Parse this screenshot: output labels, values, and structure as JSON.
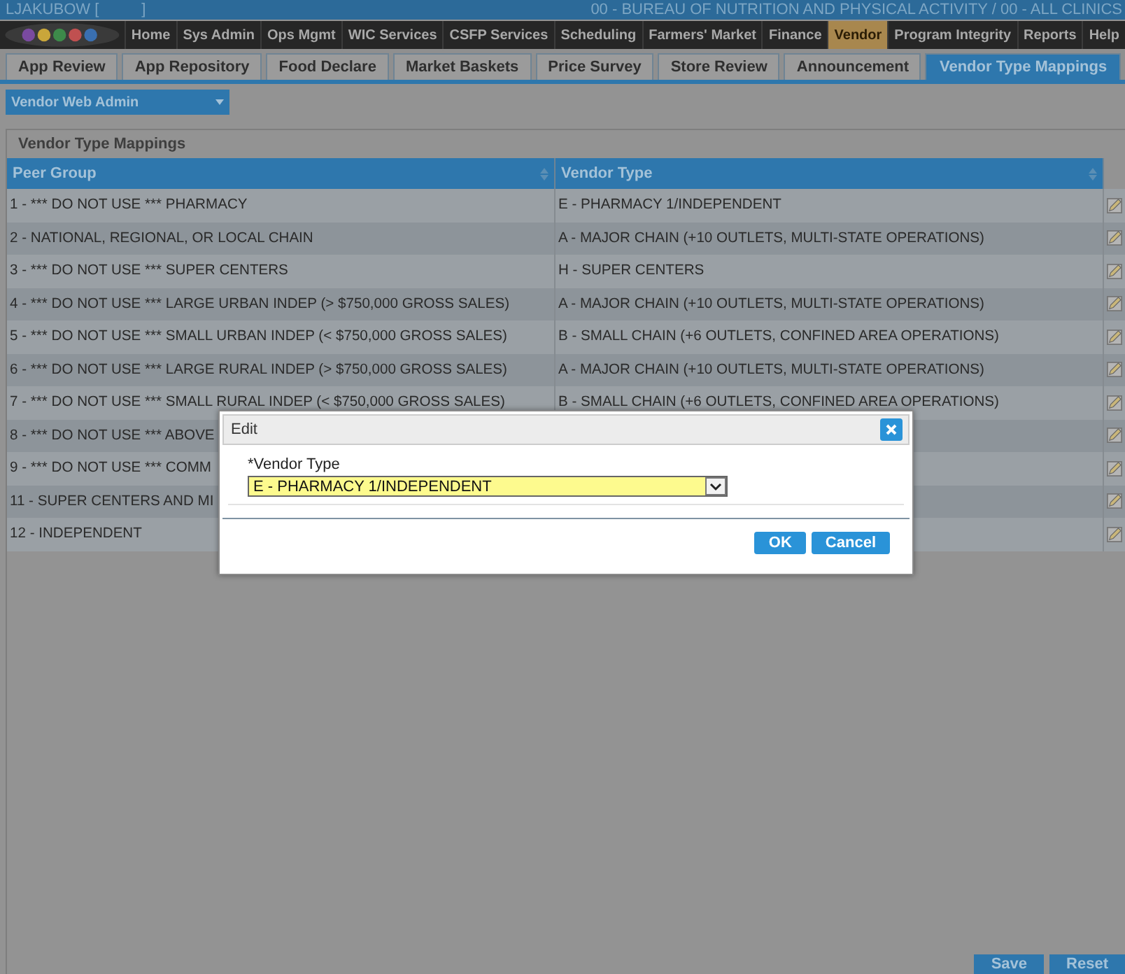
{
  "header": {
    "user": "LJAKUBOW [          ]",
    "organization": "00 - BUREAU OF NUTRITION AND PHYSICAL ACTIVITY / 00 - ALL CLINICS"
  },
  "nav": [
    {
      "label": "Home",
      "selected": false
    },
    {
      "label": "Sys Admin",
      "selected": false
    },
    {
      "label": "Ops Mgmt",
      "selected": false
    },
    {
      "label": "WIC Services",
      "selected": false
    },
    {
      "label": "CSFP Services",
      "selected": false
    },
    {
      "label": "Scheduling",
      "selected": false
    },
    {
      "label": "Farmers' Market",
      "selected": false
    },
    {
      "label": "Finance",
      "selected": false
    },
    {
      "label": "Vendor",
      "selected": true
    },
    {
      "label": "Program Integrity",
      "selected": false
    },
    {
      "label": "Reports",
      "selected": false
    },
    {
      "label": "Help",
      "selected": false
    }
  ],
  "tabs": [
    {
      "label": "App Review",
      "selected": false
    },
    {
      "label": "App Repository",
      "selected": false
    },
    {
      "label": "Food Declare",
      "selected": false
    },
    {
      "label": "Market Baskets",
      "selected": false
    },
    {
      "label": "Price Survey",
      "selected": false
    },
    {
      "label": "Store Review",
      "selected": false
    },
    {
      "label": "Announcement",
      "selected": false
    },
    {
      "label": "Vendor Type Mappings",
      "selected": true
    }
  ],
  "module_select": "Vendor Web Admin",
  "panel": {
    "title": "Vendor Type Mappings",
    "columns": [
      "Peer Group",
      "Vendor Type"
    ],
    "rows": [
      {
        "peer_group": "1 - *** DO NOT USE *** PHARMACY",
        "vendor_type": "E - PHARMACY 1/INDEPENDENT"
      },
      {
        "peer_group": "2 - NATIONAL, REGIONAL, OR LOCAL CHAIN",
        "vendor_type": "A - MAJOR CHAIN (+10 OUTLETS, MULTI-STATE OPERATIONS)"
      },
      {
        "peer_group": "3 - *** DO NOT USE *** SUPER CENTERS",
        "vendor_type": "H - SUPER CENTERS"
      },
      {
        "peer_group": "4 - *** DO NOT USE *** LARGE URBAN INDEP (> $750,000 GROSS SALES)",
        "vendor_type": "A - MAJOR CHAIN (+10 OUTLETS, MULTI-STATE OPERATIONS)"
      },
      {
        "peer_group": "5 - *** DO NOT USE *** SMALL URBAN INDEP (< $750,000 GROSS SALES)",
        "vendor_type": "B - SMALL CHAIN (+6 OUTLETS, CONFINED AREA OPERATIONS)"
      },
      {
        "peer_group": "6 - *** DO NOT USE *** LARGE RURAL INDEP (> $750,000 GROSS SALES)",
        "vendor_type": "A - MAJOR CHAIN (+10 OUTLETS, MULTI-STATE OPERATIONS)"
      },
      {
        "peer_group": "7 - *** DO NOT USE *** SMALL RURAL INDEP (< $750,000 GROSS SALES)",
        "vendor_type": "B - SMALL CHAIN (+6 OUTLETS, CONFINED AREA OPERATIONS)"
      },
      {
        "peer_group": "8 - *** DO NOT USE *** ABOVE"
      },
      {
        "peer_group": "9 - *** DO NOT USE *** COMM"
      },
      {
        "peer_group": "11 - SUPER CENTERS AND MI"
      },
      {
        "peer_group": "12 - INDEPENDENT"
      }
    ]
  },
  "dialog": {
    "title": "Edit",
    "field_label": "*Vendor Type",
    "field_value": "E - PHARMACY 1/INDEPENDENT",
    "buttons": [
      "OK",
      "Cancel"
    ]
  },
  "footer_buttons": [
    "Save",
    "Reset"
  ]
}
